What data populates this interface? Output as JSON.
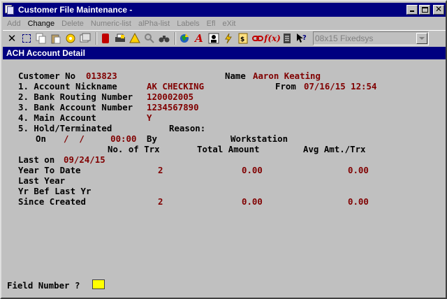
{
  "window": {
    "title": "Customer File Maintenance -",
    "minimize": "minimize",
    "maximize": "maximize",
    "close": "close"
  },
  "menu": [
    {
      "label": "Add",
      "enabled": false
    },
    {
      "label": "Change",
      "enabled": true
    },
    {
      "label": "Delete",
      "enabled": false
    },
    {
      "label": "Numeric-list",
      "enabled": false
    },
    {
      "label": "alPha-list",
      "enabled": false
    },
    {
      "label": "Labels",
      "enabled": false
    },
    {
      "label": "Efl",
      "enabled": false
    },
    {
      "label": "eXit",
      "enabled": false
    }
  ],
  "toolbar": {
    "font_selector": "08x15 Fixedsys"
  },
  "screen": {
    "header": "ACH Account Detail",
    "customer_no_label": "Customer No",
    "customer_no": "013823",
    "name_label": "Name",
    "name": "Aaron Keating",
    "fields": [
      {
        "label": "1. Account Nickname",
        "value": "AK CHECKING"
      },
      {
        "label": "2. Bank Routing Number",
        "value": "120002005"
      },
      {
        "label": "3. Bank Account Number",
        "value": "1234567890"
      },
      {
        "label": "4. Main Account",
        "value": "Y"
      },
      {
        "label": "5. Hold/Terminated",
        "value": ""
      }
    ],
    "from_label": "From",
    "from_value": "07/16/15 12:54",
    "reason_label": "Reason:",
    "on_label": "On",
    "on_value": "/  /     00:00",
    "by_label": "By",
    "workstation_label": "Workstation",
    "col_headers": {
      "trx": "No. of Trx",
      "total": "Total Amount",
      "avg": "Avg Amt./Trx"
    },
    "last_on_label": "Last on",
    "last_on_value": "09/24/15",
    "stats": [
      {
        "label": "Year To Date",
        "trx": "2",
        "total": "0.00",
        "avg": "0.00"
      },
      {
        "label": "Last Year",
        "trx": "",
        "total": "",
        "avg": ""
      },
      {
        "label": "Yr Bef Last Yr",
        "trx": "",
        "total": "",
        "avg": ""
      },
      {
        "label": "Since Created",
        "trx": "2",
        "total": "0.00",
        "avg": "0.00"
      }
    ],
    "prompt_label": "Field Number ?"
  }
}
